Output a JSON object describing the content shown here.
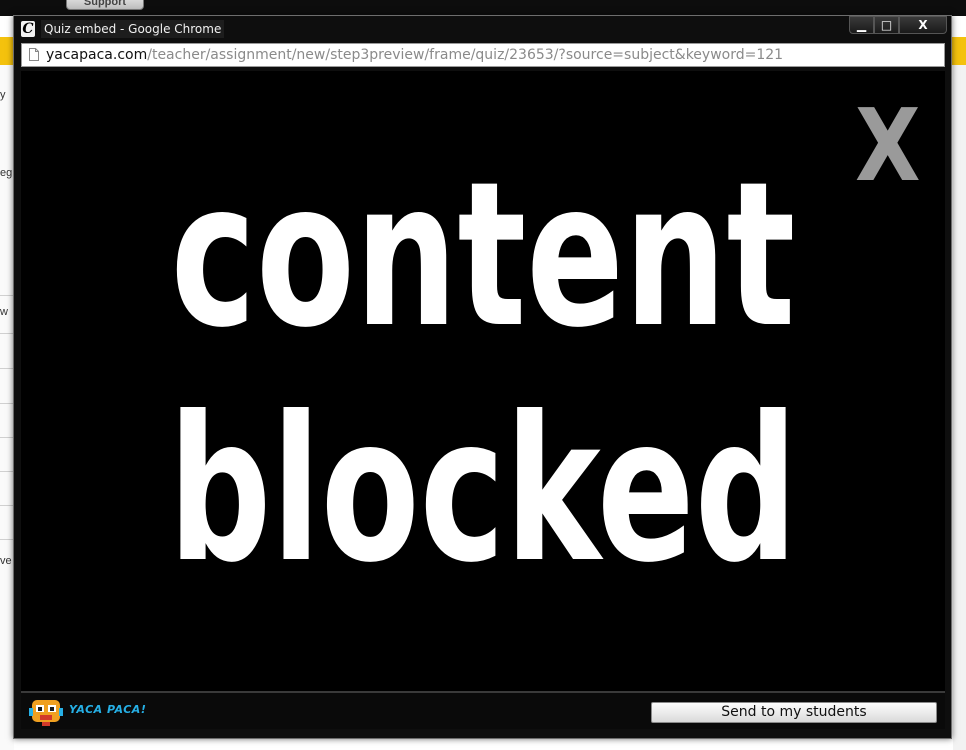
{
  "background_page": {
    "support_button_label": "Support",
    "left_fragments": [
      "y",
      "eg",
      "w",
      "ve"
    ]
  },
  "window": {
    "title": "Quiz embed - Google Chrome",
    "controls": {
      "minimize": "▁",
      "maximize": "□",
      "close": "X"
    }
  },
  "address_bar": {
    "host": "yacapaca.com",
    "path": "/teacher/assignment/new/step3preview/frame/quiz/23653/?source=subject&keyword=121"
  },
  "content": {
    "close_label": "X",
    "line1": "content",
    "line2": "blocked"
  },
  "footer": {
    "logo_text": "YACA PACA!",
    "send_button_label": "Send to my students"
  },
  "colors": {
    "accent_yellow": "#f4c20d",
    "logo_blue": "#26b0e6",
    "close_x_gray": "#9a9a9a"
  }
}
